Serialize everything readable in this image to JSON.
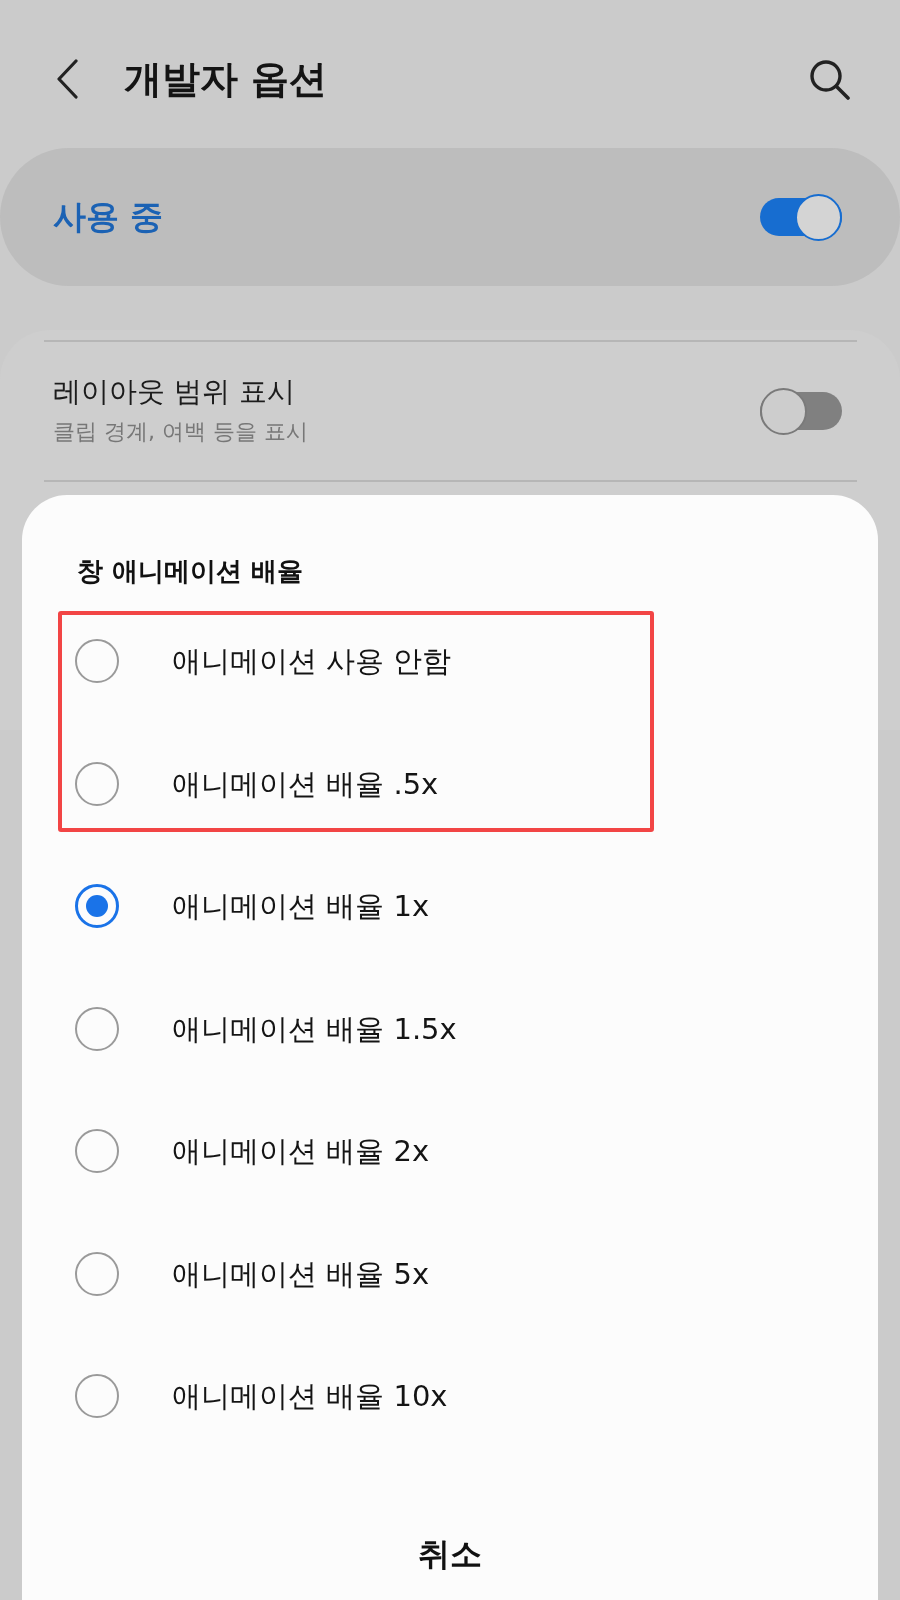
{
  "header": {
    "title": "개발자 옵션"
  },
  "master_switch": {
    "label": "사용 중",
    "on": true
  },
  "settings": [
    {
      "title": "레이아웃 범위 표시",
      "subtitle": "클립 경계, 여백 등을 표시",
      "on": false
    }
  ],
  "dialog": {
    "title": "창 애니메이션 배율",
    "options": [
      {
        "label": "애니메이션 사용 안함",
        "selected": false,
        "highlighted": true
      },
      {
        "label": "애니메이션 배율 .5x",
        "selected": false,
        "highlighted": true
      },
      {
        "label": "애니메이션 배율 1x",
        "selected": true,
        "highlighted": false
      },
      {
        "label": "애니메이션 배율 1.5x",
        "selected": false,
        "highlighted": false
      },
      {
        "label": "애니메이션 배율 2x",
        "selected": false,
        "highlighted": false
      },
      {
        "label": "애니메이션 배율 5x",
        "selected": false,
        "highlighted": false
      },
      {
        "label": "애니메이션 배율 10x",
        "selected": false,
        "highlighted": false
      }
    ],
    "cancel": "취소"
  }
}
